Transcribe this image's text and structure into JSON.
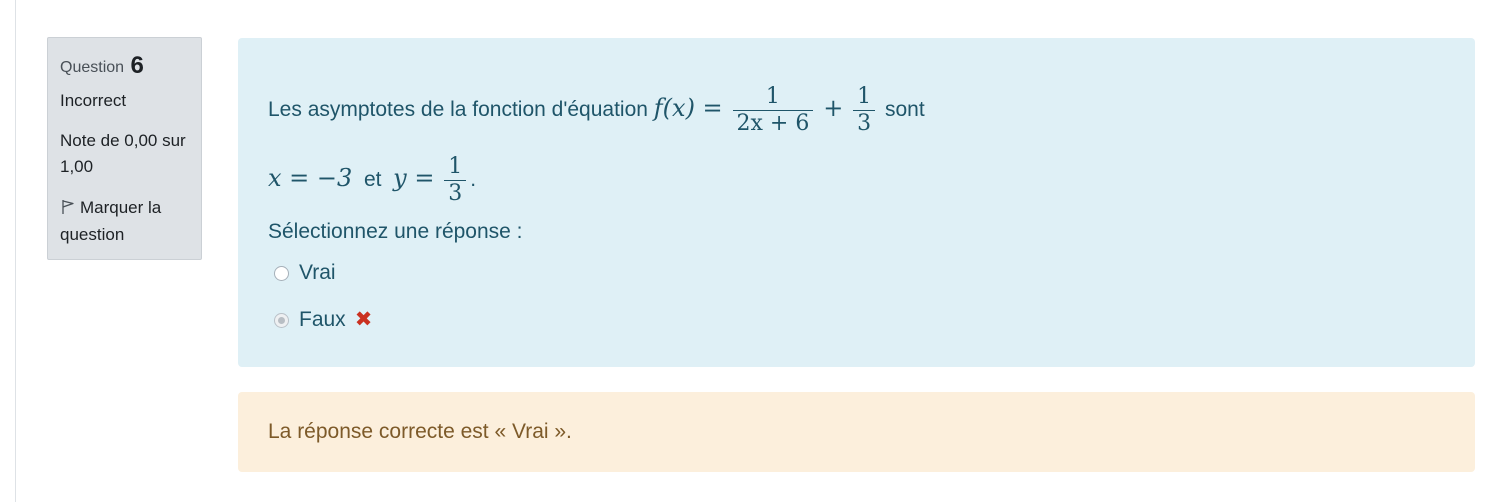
{
  "info": {
    "question_label": "Question",
    "question_number": "6",
    "state": "Incorrect",
    "grade_line1": "Note de 0,00 sur",
    "grade_line2": "1,00",
    "flag_line1": "Marquer la",
    "flag_line2": "question",
    "flag_icon": "flag-outline-icon"
  },
  "question": {
    "text_before": "Les asymptotes de la fonction d'équation",
    "func_lhs": "f(x) =",
    "frac1_num": "1",
    "frac1_den": "2x + 6",
    "plus": "+",
    "frac2_num": "1",
    "frac2_den": "3",
    "text_after": "sont",
    "asym_x": "x = −3",
    "conj": "et",
    "asym_y_lhs": "y =",
    "frac3_num": "1",
    "frac3_den": "3",
    "end_punct": "."
  },
  "prompt": "Sélectionnez une réponse :",
  "answers": [
    {
      "label": "Vrai",
      "selected": false
    },
    {
      "label": "Faux",
      "selected": true,
      "mark": "✖"
    }
  ],
  "feedback": "La réponse correcte est « Vrai ».",
  "colors": {
    "formulation_bg": "#dff0f6",
    "formulation_text": "#1f5569",
    "feedback_bg": "#fcefdc",
    "feedback_text": "#7d5a29",
    "incorrect_mark": "#ca3120",
    "info_bg": "#dee2e6"
  }
}
